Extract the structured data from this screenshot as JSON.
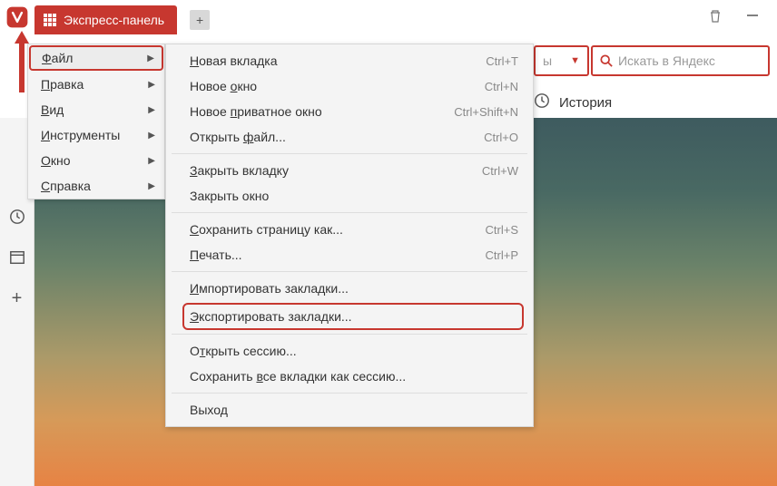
{
  "titlebar": {
    "tab_label": "Экспресс-панель"
  },
  "menubar": {
    "items": [
      {
        "prefix": "Ф",
        "rest": "айл",
        "active": true
      },
      {
        "prefix": "П",
        "rest": "равка"
      },
      {
        "prefix": "В",
        "rest": "ид"
      },
      {
        "prefix": "И",
        "rest": "нструменты"
      },
      {
        "prefix": "О",
        "rest": "кно"
      },
      {
        "prefix": "С",
        "rest": "правка"
      }
    ]
  },
  "submenu": {
    "groups": [
      [
        {
          "pre": "",
          "u": "Н",
          "post": "овая вкладка",
          "shortcut": "Ctrl+T"
        },
        {
          "pre": "Новое ",
          "u": "о",
          "post": "кно",
          "shortcut": "Ctrl+N"
        },
        {
          "pre": "Новое ",
          "u": "п",
          "post": "риватное окно",
          "shortcut": "Ctrl+Shift+N"
        },
        {
          "pre": "Открыть ",
          "u": "ф",
          "post": "айл...",
          "shortcut": "Ctrl+O"
        }
      ],
      [
        {
          "pre": "",
          "u": "З",
          "post": "акрыть вкладку",
          "shortcut": "Ctrl+W"
        },
        {
          "pre": "Закрыть окно",
          "u": "",
          "post": "",
          "shortcut": ""
        }
      ],
      [
        {
          "pre": "",
          "u": "С",
          "post": "охранить страницу как...",
          "shortcut": "Ctrl+S"
        },
        {
          "pre": "",
          "u": "П",
          "post": "ечать...",
          "shortcut": "Ctrl+P"
        }
      ],
      [
        {
          "pre": "",
          "u": "И",
          "post": "мпортировать закладки...",
          "shortcut": ""
        },
        {
          "pre": "",
          "u": "Э",
          "post": "кспортировать закладки...",
          "shortcut": "",
          "highlight": true
        }
      ],
      [
        {
          "pre": "О",
          "u": "т",
          "post": "крыть сессию...",
          "shortcut": ""
        },
        {
          "pre": "Сохранить ",
          "u": "в",
          "post": "се вкладки как сессию...",
          "shortcut": ""
        }
      ],
      [
        {
          "pre": "Выход",
          "u": "",
          "post": "",
          "shortcut": ""
        }
      ]
    ]
  },
  "toolbar": {
    "select_placeholder": "ы",
    "search_placeholder": "Искать в Яндекс"
  },
  "toolbar2": {
    "history_label": "История"
  }
}
